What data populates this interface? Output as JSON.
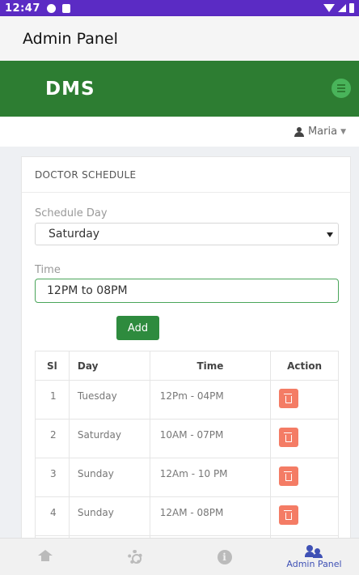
{
  "status_bar": {
    "time": "12:47"
  },
  "app_bar": {
    "title": "Admin Panel"
  },
  "brand": {
    "title": "DMS"
  },
  "user": {
    "name": "Maria"
  },
  "card": {
    "title": "DOCTOR SCHEDULE",
    "schedule_day_label": "Schedule Day",
    "schedule_day_value": "Saturday",
    "time_label": "Time",
    "time_value": "12PM to 08PM",
    "add_label": "Add"
  },
  "table": {
    "headers": {
      "sl": "Sl",
      "day": "Day",
      "time": "Time",
      "action": "Action"
    },
    "rows": [
      {
        "sl": "1",
        "day": "Tuesday",
        "time": "12Pm - 04PM"
      },
      {
        "sl": "2",
        "day": "Saturday",
        "time": "10AM - 07PM"
      },
      {
        "sl": "3",
        "day": "Sunday",
        "time": "12Am - 10 PM"
      },
      {
        "sl": "4",
        "day": "Sunday",
        "time": "12AM - 08PM"
      },
      {
        "sl": "",
        "day": "",
        "time": ""
      }
    ]
  },
  "bottom_nav": {
    "active_label": "Admin Panel",
    "icons": [
      "home-icon",
      "gear-icon",
      "info-icon",
      "admin-icon"
    ]
  },
  "colors": {
    "status_bar": "#5b2bc4",
    "brand_green": "#2d7d32",
    "add_button": "#2e8b3e",
    "delete_button": "#f47c65",
    "active_nav": "#3f51b5"
  }
}
